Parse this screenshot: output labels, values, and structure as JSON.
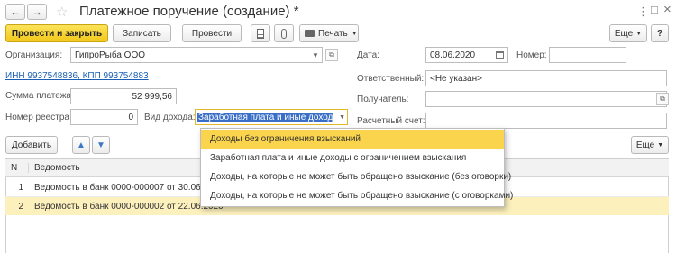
{
  "window": {
    "title": "Платежное поручение (создание) *"
  },
  "nav": {
    "back_icon": "←",
    "forward_icon": "→",
    "star_icon": "☆",
    "more_icon": "⋮",
    "max_icon": "□",
    "close_icon": "×"
  },
  "toolbar": {
    "post_close": "Провести и закрыть",
    "save": "Записать",
    "post": "Провести",
    "print": "Печать",
    "more": "Еще"
  },
  "form": {
    "org_label": "Организация:",
    "org_value": "ГипроРыба ООО",
    "inn_kpp": "ИНН 9937548836, КПП 993754883",
    "amount_label": "Сумма платежа:",
    "amount_value": "52 999,56",
    "registry_label": "Номер реестра:",
    "registry_value": "0",
    "income_label": "Вид дохода:",
    "income_value": "Заработная плата и иные доходы с",
    "date_label": "Дата:",
    "date_value": "08.06.2020",
    "number_label": "Номер:",
    "number_value": "",
    "responsible_label": "Ответственный:",
    "responsible_value": "<Не указан>",
    "recipient_label": "Получатель:",
    "recipient_value": "",
    "account_label": "Расчетный счет:"
  },
  "table_toolbar": {
    "add": "Добавить",
    "more": "Еще"
  },
  "table": {
    "columns": [
      "N",
      "Ведомость"
    ],
    "rows": [
      {
        "n": "1",
        "name": "Ведомость в банк 0000-000007 от 30.06.2020"
      },
      {
        "n": "2",
        "name": "Ведомость в банк 0000-000002 от 22.06.2020"
      }
    ]
  },
  "dropdown": {
    "options": [
      "Доходы без ограничения взысканий",
      "Заработная плата и иные доходы с ограничением взыскания",
      "Доходы, на которые не может быть обращено взыскание (без оговорки)",
      "Доходы, на которые не может быть обращено взыскание (с оговорками)"
    ],
    "highlighted_index": 0
  },
  "colors": {
    "accent": "#f2c81a",
    "link": "#1a5fb4",
    "selected_row": "#fcf0bd"
  }
}
